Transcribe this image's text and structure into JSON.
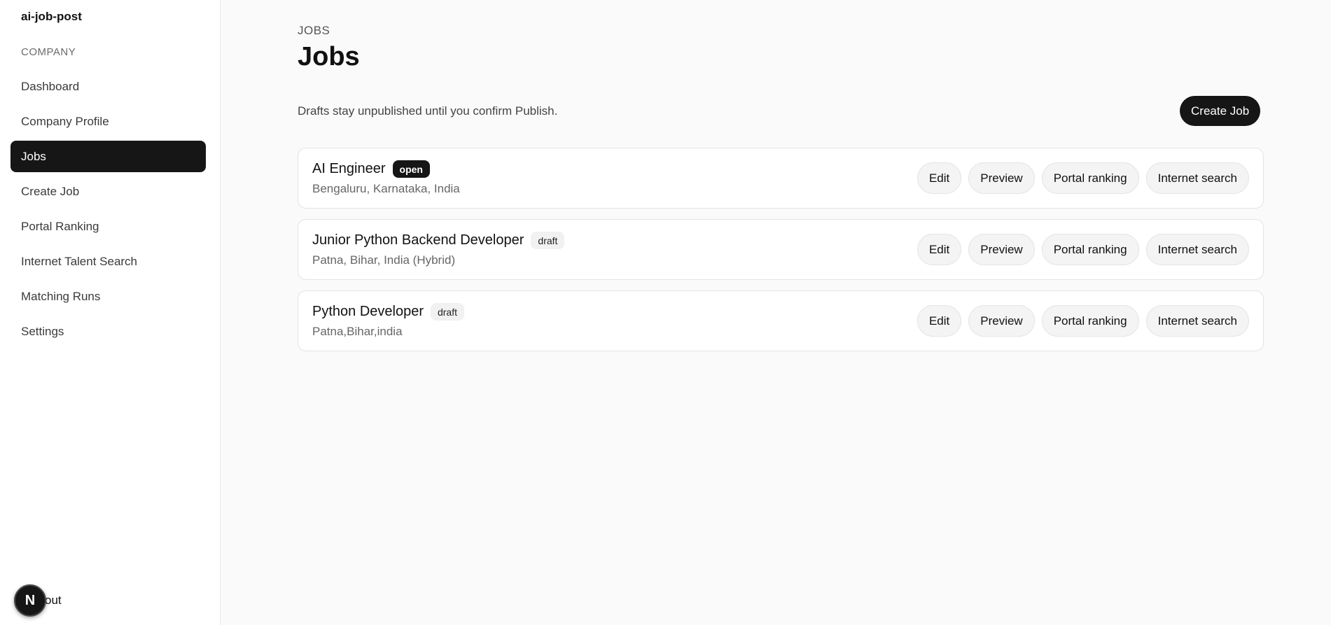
{
  "sidebar": {
    "brand": "ai-job-post",
    "section_label": "COMPANY",
    "items": [
      {
        "label": "Dashboard",
        "active": false
      },
      {
        "label": "Company Profile",
        "active": false
      },
      {
        "label": "Jobs",
        "active": true
      },
      {
        "label": "Create Job",
        "active": false
      },
      {
        "label": "Portal Ranking",
        "active": false
      },
      {
        "label": "Internet Talent Search",
        "active": false
      },
      {
        "label": "Matching Runs",
        "active": false
      },
      {
        "label": "Settings",
        "active": false
      }
    ],
    "logout_label": "out",
    "badge_letter": "N"
  },
  "main": {
    "breadcrumb": "JOBS",
    "title": "Jobs",
    "subtitle": "Drafts stay unpublished until you confirm Publish.",
    "create_button": "Create Job",
    "jobs": [
      {
        "title": "AI Engineer",
        "status": "open",
        "location": "Bengaluru, Karnataka, India",
        "actions": [
          "Edit",
          "Preview",
          "Portal ranking",
          "Internet search"
        ]
      },
      {
        "title": "Junior Python Backend Developer",
        "status": "draft",
        "location": "Patna, Bihar, India (Hybrid)",
        "actions": [
          "Edit",
          "Preview",
          "Portal ranking",
          "Internet search"
        ]
      },
      {
        "title": "Python Developer",
        "status": "draft",
        "location": "Patna,Bihar,india",
        "actions": [
          "Edit",
          "Preview",
          "Portal ranking",
          "Internet search"
        ]
      }
    ]
  },
  "colors": {
    "accent_dark": "#161616",
    "background": "#fafafa",
    "card": "#ffffff"
  }
}
